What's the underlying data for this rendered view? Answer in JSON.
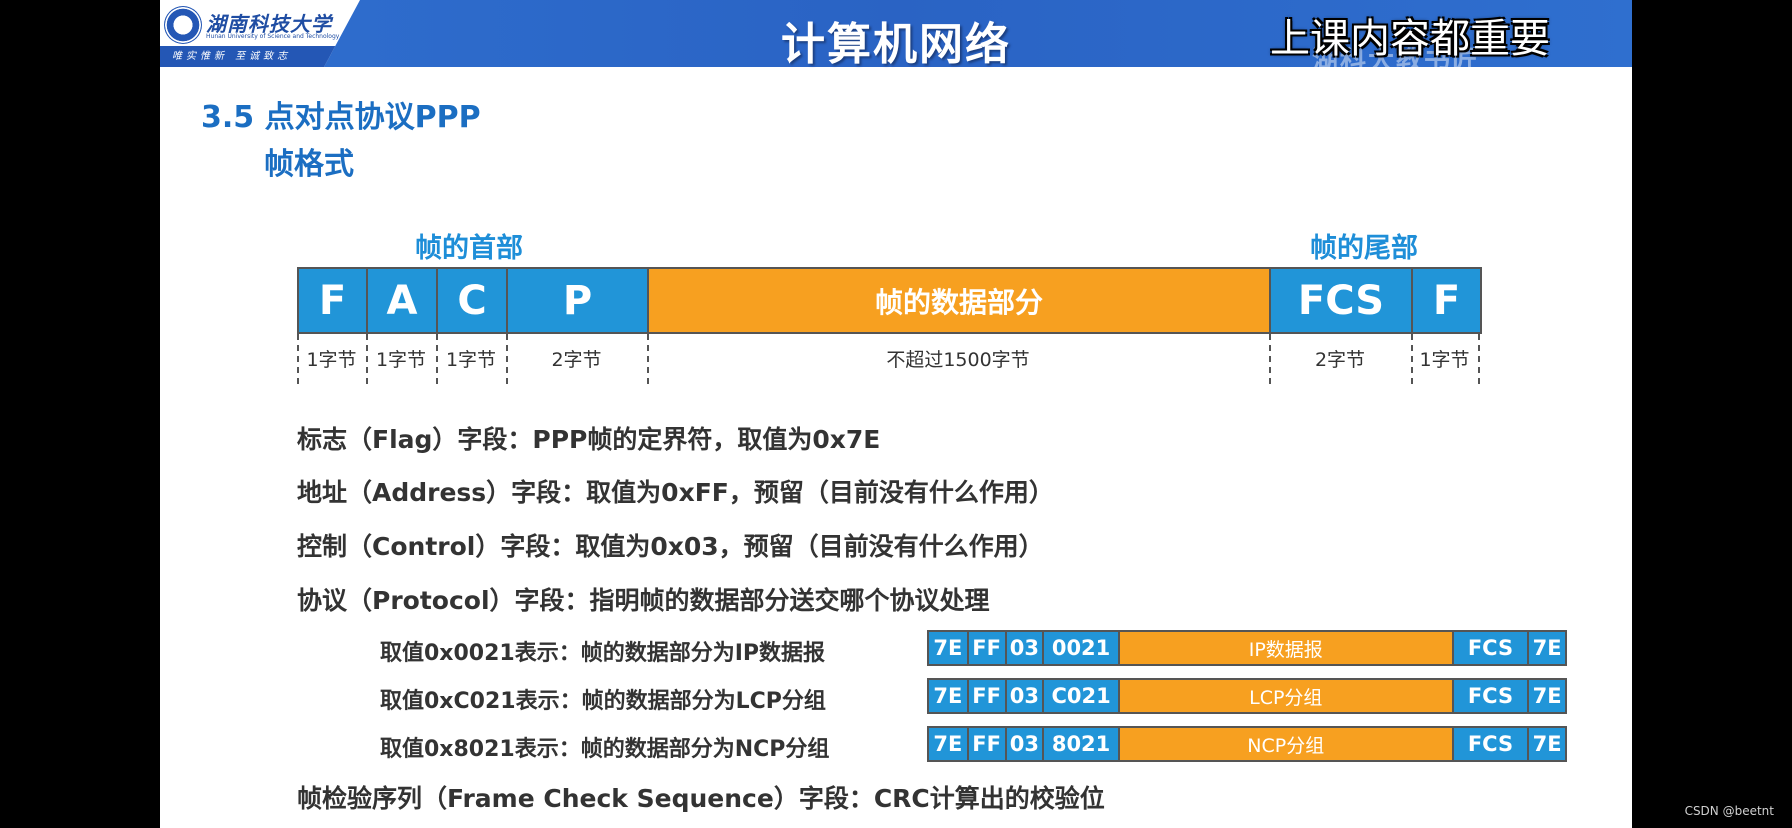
{
  "header": {
    "logo_text": "湖南科技大学",
    "logo_en": "Hunan University of Science and Technology",
    "logo_motto": "唯实惟新 至诚致志",
    "course_title": "计算机网络",
    "ghost_text": "湖科大教书匠",
    "subtitle_overlay": "上课内容都重要"
  },
  "section": {
    "title": "3.5 点对点协议PPP",
    "subtitle": "帧格式"
  },
  "frame": {
    "header_label": "帧的首部",
    "trailer_label": "帧的尾部",
    "fields": [
      {
        "label": "F",
        "size": "1字节"
      },
      {
        "label": "A",
        "size": "1字节"
      },
      {
        "label": "C",
        "size": "1字节"
      },
      {
        "label": "P",
        "size": "2字节"
      },
      {
        "label": "帧的数据部分",
        "size": "不超过1500字节"
      },
      {
        "label": "FCS",
        "size": "2字节"
      },
      {
        "label": "F",
        "size": "1字节"
      }
    ]
  },
  "descriptions": [
    "标志（Flag）字段：PPP帧的定界符，取值为0x7E",
    "地址（Address）字段：取值为0xFF，预留（目前没有什么作用）",
    "控制（Control）字段：取值为0x03，预留（目前没有什么作用）",
    "协议（Protocol）字段：指明帧的数据部分送交哪个协议处理"
  ],
  "protocol_examples": [
    {
      "text": "取值0x0021表示：帧的数据部分为IP数据报",
      "fields": [
        "7E",
        "FF",
        "03",
        "0021",
        "IP数据报",
        "FCS",
        "7E"
      ]
    },
    {
      "text": "取值0xC021表示：帧的数据部分为LCP分组",
      "fields": [
        "7E",
        "FF",
        "03",
        "C021",
        "LCP分组",
        "FCS",
        "7E"
      ]
    },
    {
      "text": "取值0x8021表示：帧的数据部分为NCP分组",
      "fields": [
        "7E",
        "FF",
        "03",
        "8021",
        "NCP分组",
        "FCS",
        "7E"
      ]
    }
  ],
  "fcs_description": "帧检验序列（Frame Check Sequence）字段：CRC计算出的校验位",
  "watermark": "CSDN @beetnt",
  "colors": {
    "blue": "#2195d8",
    "orange": "#f7a020",
    "title_blue": "#1b6ec2"
  }
}
